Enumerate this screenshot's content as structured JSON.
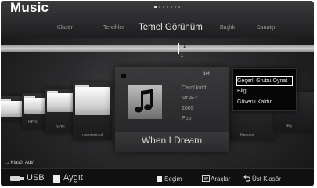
{
  "header": {
    "title": "Music",
    "tabs": [
      {
        "label": "Klasör"
      },
      {
        "label": "Tercihler"
      },
      {
        "label": "Temel Görünüm"
      },
      {
        "label": "Başlık"
      },
      {
        "label": "Sanatçı"
      }
    ],
    "active_tab": "Temel Görünüm",
    "page_count": 7,
    "current_page": 1
  },
  "timeline": {
    "index": "1",
    "count": "1"
  },
  "folders": [
    {
      "name": "NPKI"
    },
    {
      "name": "NPKI"
    },
    {
      "name": "usermanual"
    },
    {
      "name": "Heaven"
    },
    {
      "name": "Sky"
    }
  ],
  "selected_item": {
    "page_indicator": "3/4",
    "artist": "Carol kidd",
    "album": "Mr A-Z",
    "year": "2009",
    "genre": "Pop",
    "title": "When I Dream",
    "icon": "music-note-icon"
  },
  "context_menu": {
    "items": [
      {
        "label": "Geçerli Grubu Oynat",
        "selected": true
      },
      {
        "label": "Bilgi",
        "selected": false
      },
      {
        "label": "Güvenli Kaldır",
        "selected": false
      }
    ]
  },
  "breadcrumb": "../ Klasör Adı/",
  "footer": {
    "usb_label": "USB",
    "device_label": "Aygıt",
    "select_label": "Seçim",
    "tools_label": "Araçlar",
    "up_label": "Üst Klasör"
  },
  "colors": {
    "menu_background": "#050505",
    "selection_border": "#ffffff",
    "accent_text": "#e6e6e6"
  }
}
